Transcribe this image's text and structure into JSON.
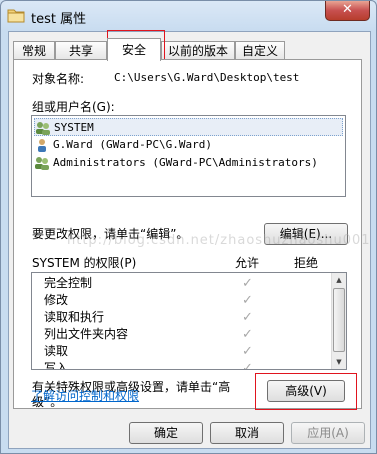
{
  "window": {
    "title": "test 属性",
    "close_label": "✕"
  },
  "tabs": [
    {
      "label": "常规"
    },
    {
      "label": "共享"
    },
    {
      "label": "安全"
    },
    {
      "label": "以前的版本"
    },
    {
      "label": "自定义"
    }
  ],
  "object": {
    "label": "对象名称:",
    "value": "C:\\Users\\G.Ward\\Desktop\\test"
  },
  "groups": {
    "label": "组或用户名(G):",
    "items": [
      {
        "name": "SYSTEM"
      },
      {
        "name": "G.Ward (GWard-PC\\G.Ward)"
      },
      {
        "name": "Administrators (GWard-PC\\Administrators)"
      }
    ]
  },
  "edit": {
    "hint": "要更改权限，请单击“编辑”。",
    "button": "编辑(E)..."
  },
  "permissions": {
    "title": "SYSTEM 的权限(P)",
    "allow_header": "允许",
    "deny_header": "拒绝",
    "items": [
      {
        "name": "完全控制",
        "allow": true
      },
      {
        "name": "修改",
        "allow": true
      },
      {
        "name": "读取和执行",
        "allow": true
      },
      {
        "name": "列出文件夹内容",
        "allow": true
      },
      {
        "name": "读取",
        "allow": true
      },
      {
        "name": "写入",
        "allow": true
      }
    ]
  },
  "advanced": {
    "hint_line1": "有关特殊权限或高级设置，请单击“高",
    "hint_line2": "级”。",
    "button": "高级(V)"
  },
  "link": {
    "label": "了解访问控制和权限"
  },
  "footer": {
    "ok": "确定",
    "cancel": "取消",
    "apply": "应用(A)"
  },
  "watermark": {
    "text": "http://blog.csdn.net/zhaoshuzhaoshu001"
  }
}
